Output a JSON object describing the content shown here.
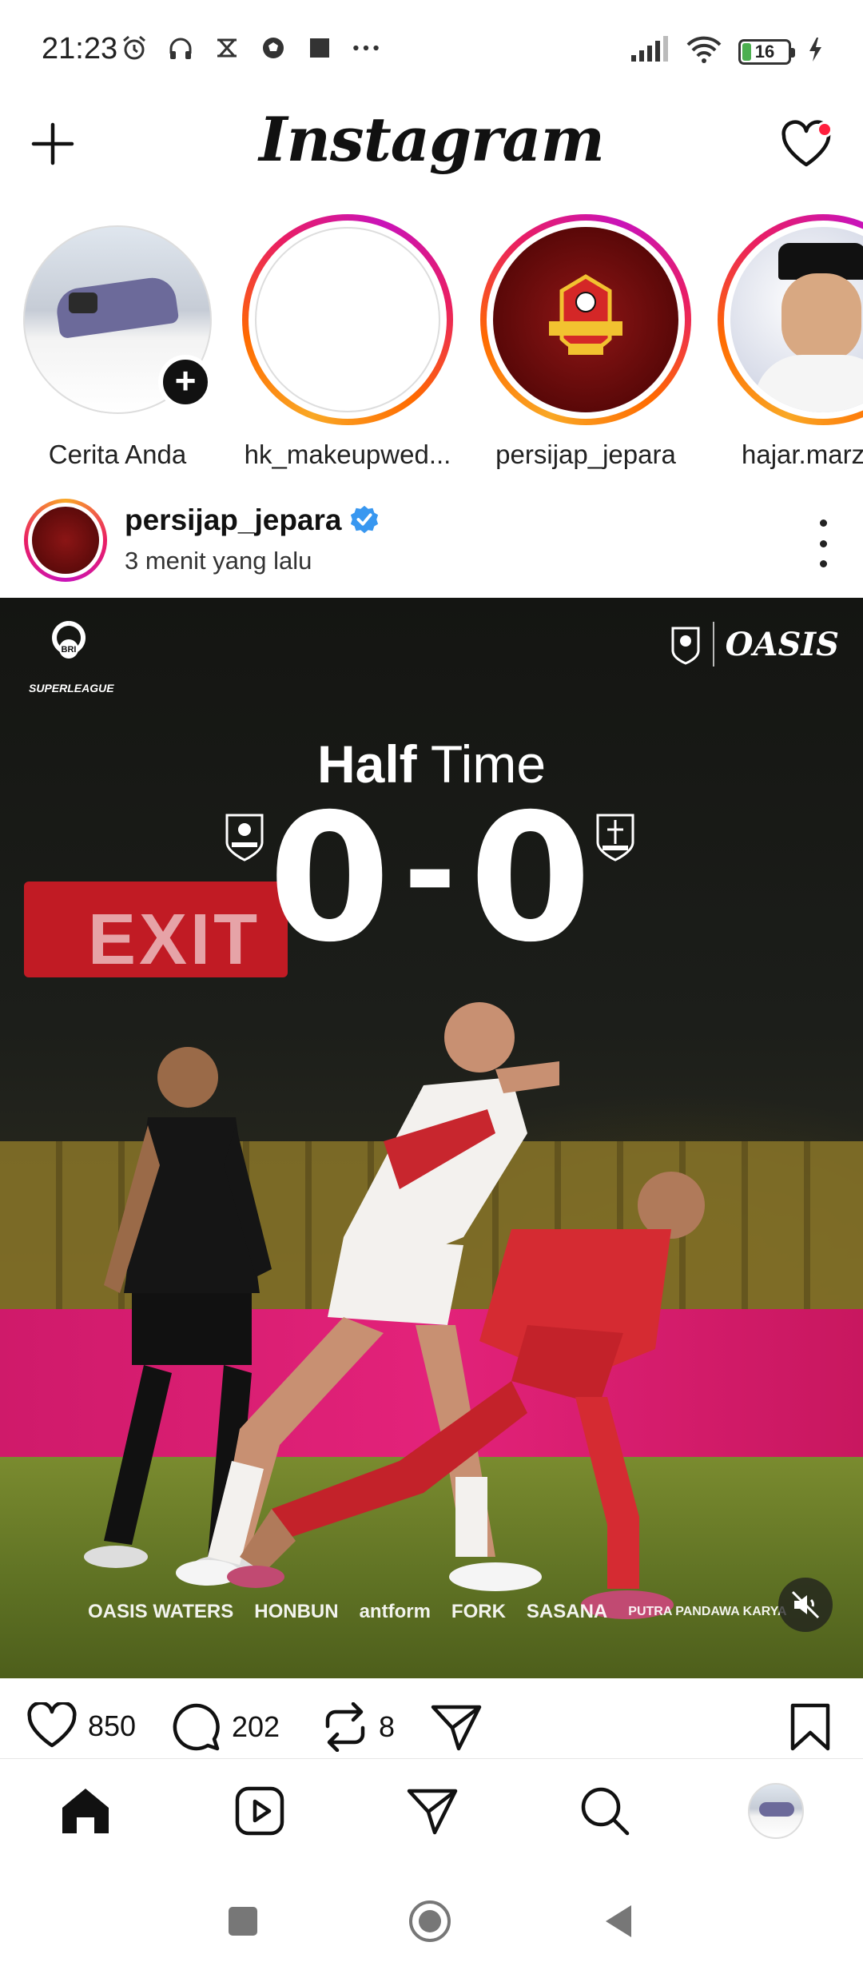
{
  "status_bar": {
    "time": "21:23",
    "battery_level": "16",
    "left_icons": [
      "alarm-icon",
      "headphones-icon",
      "notification-icon",
      "ball-icon",
      "square-icon",
      "more-dots-icon"
    ],
    "right_icons": [
      "signal-icon",
      "wifi-icon",
      "battery-icon",
      "charging-icon"
    ]
  },
  "header": {
    "logo_text": "Instagram",
    "notification_dot_color": "#ff1f3d"
  },
  "stories": [
    {
      "label": "Cerita Anda",
      "type": "own"
    },
    {
      "label": "hk_makeupwed...",
      "type": "unseen"
    },
    {
      "label": "persijap_jepara",
      "type": "unseen"
    },
    {
      "label": "hajar.marz",
      "type": "unseen"
    }
  ],
  "post": {
    "username": "persijap_jepara",
    "verified": true,
    "time_ago": "3 menit yang lalu",
    "media": {
      "league_label": "SUPERLEAGUE",
      "sponsor_top": "OASIS",
      "title_bold": "Half",
      "title_regular": "Time",
      "score_home": "0",
      "score_away": "0",
      "score_separator": "-",
      "banner_text": "EXIT",
      "sponsors": [
        "OASIS WATERS",
        "HONBUN",
        "antform",
        "FORK",
        "SASANA",
        "PUTRA PANDAWA KARYA"
      ]
    },
    "likes": "850",
    "comments": "202",
    "reposts": "8"
  },
  "bottom_nav": [
    "home-icon",
    "reels-icon",
    "send-icon",
    "search-icon",
    "profile-avatar"
  ],
  "system_nav": [
    "recents-button",
    "home-button",
    "back-button"
  ]
}
